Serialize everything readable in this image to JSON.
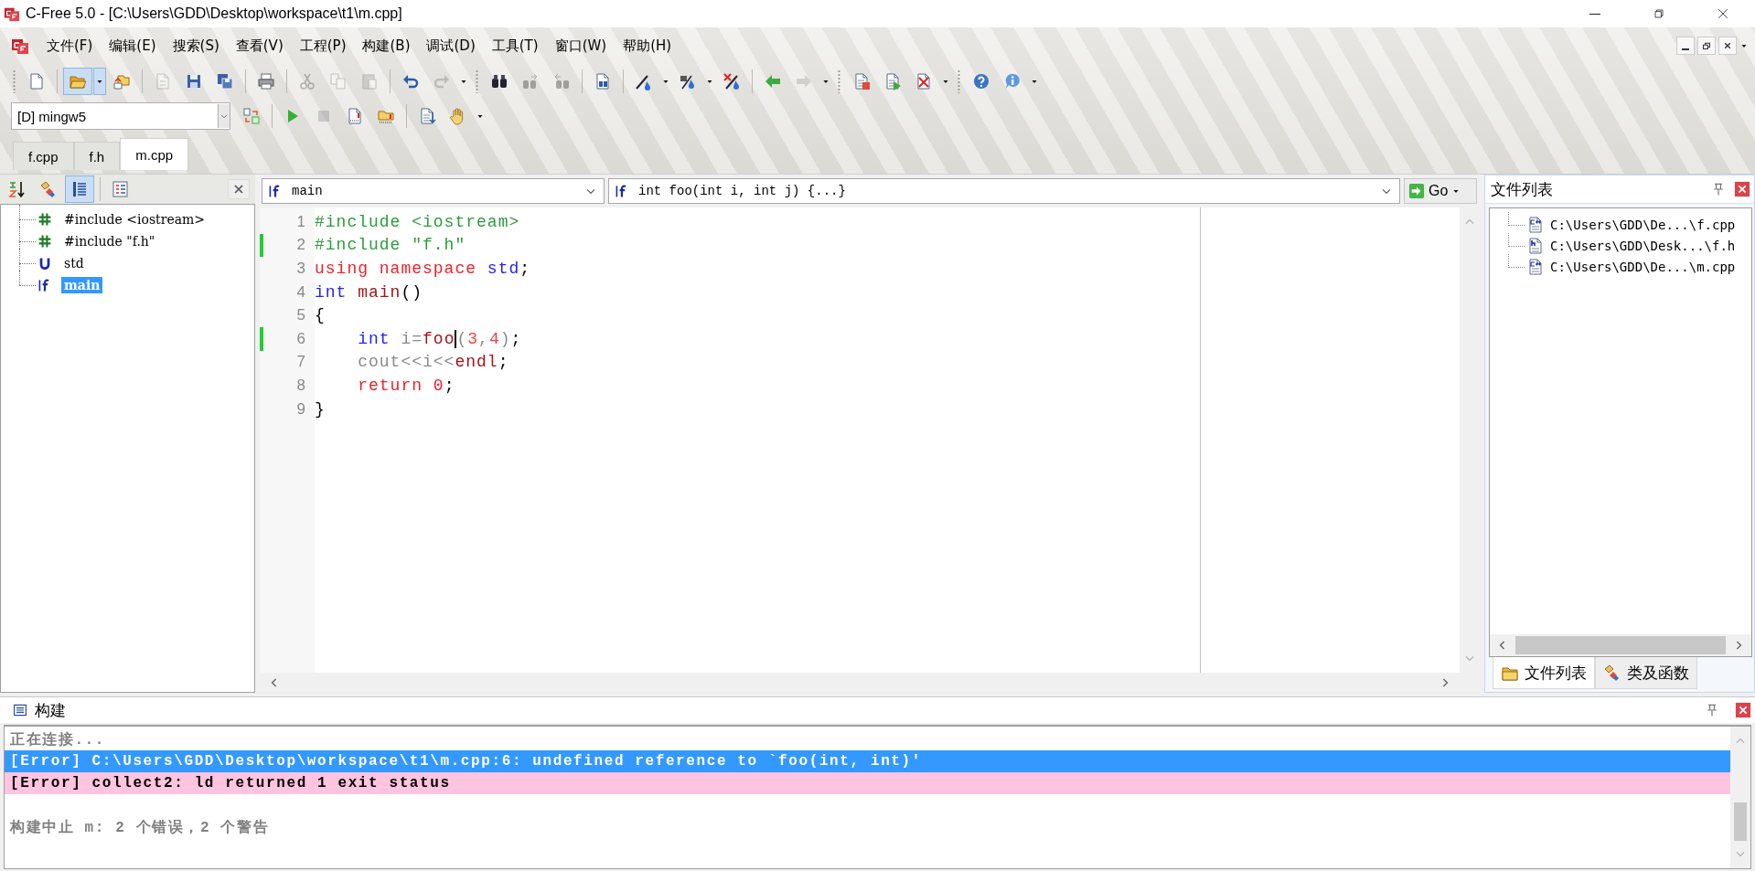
{
  "window": {
    "title": "C-Free 5.0 - [C:\\Users\\GDD\\Desktop\\workspace\\t1\\m.cpp]"
  },
  "menu": [
    "文件(F)",
    "编辑(E)",
    "搜索(S)",
    "查看(V)",
    "工程(P)",
    "构建(B)",
    "调试(D)",
    "工具(T)",
    "窗口(W)",
    "帮助(H)"
  ],
  "toolbar_1": {
    "items": [
      {
        "kind": "button",
        "disabled": false,
        "pressed": false
      },
      {
        "kind": "separator"
      },
      {
        "kind": "button",
        "disabled": false,
        "pressed": true
      },
      {
        "kind": "dropdown",
        "pressed": true
      },
      {
        "kind": "button",
        "disabled": false,
        "pressed": false
      },
      {
        "kind": "separator"
      },
      {
        "kind": "button",
        "disabled": true,
        "pressed": false
      },
      {
        "kind": "button",
        "disabled": false,
        "pressed": false
      },
      {
        "kind": "button",
        "disabled": false,
        "pressed": false
      },
      {
        "kind": "separator"
      },
      {
        "kind": "button",
        "disabled": false,
        "pressed": false
      },
      {
        "kind": "separator"
      },
      {
        "kind": "button",
        "disabled": true,
        "pressed": false
      },
      {
        "kind": "button",
        "disabled": true,
        "pressed": false
      },
      {
        "kind": "button",
        "disabled": true,
        "pressed": false
      },
      {
        "kind": "separator"
      },
      {
        "kind": "button",
        "disabled": false,
        "pressed": false
      },
      {
        "kind": "button",
        "disabled": true,
        "pressed": false
      },
      {
        "kind": "dropdown",
        "pressed": false
      },
      {
        "kind": "grip"
      },
      {
        "kind": "button",
        "disabled": false,
        "pressed": false
      },
      {
        "kind": "button",
        "disabled": true,
        "pressed": false
      },
      {
        "kind": "button",
        "disabled": true,
        "pressed": false
      },
      {
        "kind": "separator"
      },
      {
        "kind": "button",
        "disabled": false,
        "pressed": false
      },
      {
        "kind": "separator"
      },
      {
        "kind": "button",
        "disabled": false,
        "pressed": false
      },
      {
        "kind": "dropdown",
        "pressed": false
      },
      {
        "kind": "button",
        "disabled": false,
        "pressed": false
      },
      {
        "kind": "dropdown",
        "pressed": false
      },
      {
        "kind": "button",
        "disabled": false,
        "pressed": false
      },
      {
        "kind": "separator"
      },
      {
        "kind": "button",
        "disabled": false,
        "pressed": false
      },
      {
        "kind": "button",
        "disabled": true,
        "pressed": false
      },
      {
        "kind": "dropdown",
        "pressed": false
      },
      {
        "kind": "grip"
      },
      {
        "kind": "button",
        "disabled": false,
        "pressed": false
      },
      {
        "kind": "button",
        "disabled": false,
        "pressed": false
      },
      {
        "kind": "button",
        "disabled": false,
        "pressed": false
      },
      {
        "kind": "dropdown",
        "pressed": false
      },
      {
        "kind": "grip"
      },
      {
        "kind": "button",
        "disabled": false,
        "pressed": false
      },
      {
        "kind": "button",
        "disabled": false,
        "pressed": false
      },
      {
        "kind": "dropdown",
        "pressed": false
      }
    ]
  },
  "toolbar_2": {
    "compiler": "[D] mingw5",
    "items": [
      {
        "kind": "button",
        "disabled": false,
        "pressed": false
      },
      {
        "kind": "separator"
      },
      {
        "kind": "button",
        "disabled": false,
        "pressed": false
      },
      {
        "kind": "button",
        "disabled": true,
        "pressed": false
      },
      {
        "kind": "button",
        "disabled": false,
        "pressed": false
      },
      {
        "kind": "button",
        "disabled": false,
        "pressed": false
      },
      {
        "kind": "separator"
      },
      {
        "kind": "button",
        "disabled": false,
        "pressed": false
      },
      {
        "kind": "button",
        "disabled": false,
        "pressed": false
      },
      {
        "kind": "dropdown",
        "pressed": false
      }
    ]
  },
  "tabs": [
    {
      "label": "f.cpp",
      "selected": false
    },
    {
      "label": "f.h",
      "selected": false
    },
    {
      "label": "m.cpp",
      "selected": true
    }
  ],
  "symbol_panel": {
    "tools": [
      {
        "kind": "button",
        "pressed": false
      },
      {
        "kind": "button",
        "pressed": false
      },
      {
        "kind": "button",
        "pressed": true
      },
      {
        "kind": "separator"
      },
      {
        "kind": "button",
        "pressed": false
      }
    ],
    "tree": [
      {
        "kind": "include",
        "label": "#include <iostream>",
        "selected": false
      },
      {
        "kind": "include",
        "label": "#include \"f.h\"",
        "selected": false
      },
      {
        "kind": "namespace",
        "label": "std",
        "selected": false
      },
      {
        "kind": "function",
        "label": "main",
        "selected": true
      }
    ]
  },
  "editor": {
    "scope": "main",
    "function": "int foo(int i, int j) {...}",
    "go_button": "Go",
    "lines": [
      {
        "number": "1",
        "changed": false,
        "tokens": [
          {
            "kind": "preprocessor",
            "text": "#include <iostream>"
          }
        ]
      },
      {
        "number": "2",
        "changed": true,
        "tokens": [
          {
            "kind": "preprocessor",
            "text": "#include \"f.h\""
          }
        ]
      },
      {
        "number": "3",
        "changed": false,
        "tokens": [
          {
            "kind": "keyword",
            "text": "using namespace"
          },
          {
            "kind": "type",
            "text": " std"
          },
          {
            "kind": "plain",
            "text": ";"
          }
        ]
      },
      {
        "number": "4",
        "changed": false,
        "tokens": [
          {
            "kind": "type",
            "text": "int"
          },
          {
            "kind": "function",
            "text": " main"
          },
          {
            "kind": "plain",
            "text": "()"
          }
        ]
      },
      {
        "number": "5",
        "changed": false,
        "tokens": [
          {
            "kind": "plain",
            "text": "{"
          }
        ]
      },
      {
        "number": "6",
        "changed": true,
        "tokens": [
          {
            "kind": "type",
            "text": "    int"
          },
          {
            "kind": "identifier",
            "text": " i="
          },
          {
            "kind": "function",
            "text": "foo",
            "caret": true
          },
          {
            "kind": "identifier",
            "text": "("
          },
          {
            "kind": "number",
            "text": "3"
          },
          {
            "kind": "identifier",
            "text": ","
          },
          {
            "kind": "number",
            "text": "4"
          },
          {
            "kind": "identifier",
            "text": ")"
          },
          {
            "kind": "plain",
            "text": ";"
          }
        ]
      },
      {
        "number": "7",
        "changed": false,
        "tokens": [
          {
            "kind": "identifier",
            "text": "    cout<<i<<"
          },
          {
            "kind": "function",
            "text": "endl"
          },
          {
            "kind": "plain",
            "text": ";"
          }
        ]
      },
      {
        "number": "8",
        "changed": false,
        "tokens": [
          {
            "kind": "keyword",
            "text": "    return 0"
          },
          {
            "kind": "plain",
            "text": ";"
          }
        ]
      },
      {
        "number": "9",
        "changed": false,
        "tokens": [
          {
            "kind": "plain",
            "text": "}"
          }
        ]
      }
    ]
  },
  "file_panel": {
    "title": "文件列表",
    "files": [
      {
        "kind": "cpp",
        "label": "C:\\Users\\GDD\\De...\\f.cpp"
      },
      {
        "kind": "header",
        "label": "C:\\Users\\GDD\\Desk...\\f.h"
      },
      {
        "kind": "cpp",
        "label": "C:\\Users\\GDD\\De...\\m.cpp"
      }
    ],
    "tabs": [
      {
        "label": "文件列表",
        "selected": true
      },
      {
        "label": "类及函数",
        "selected": false
      }
    ]
  },
  "build_panel": {
    "title": "构建",
    "lines": [
      {
        "kind": "info",
        "text": "正在连接...",
        "selected": false
      },
      {
        "kind": "error",
        "text": "[Error] C:\\Users\\GDD\\Desktop\\workspace\\t1\\m.cpp:6: undefined reference to `foo(int, int)'",
        "selected": true
      },
      {
        "kind": "error",
        "text": "[Error] collect2: ld returned 1 exit status",
        "selected": false
      },
      {
        "kind": "summary",
        "text": "构建中止 m: 2 个错误，2 个警告",
        "selected": false
      }
    ]
  }
}
